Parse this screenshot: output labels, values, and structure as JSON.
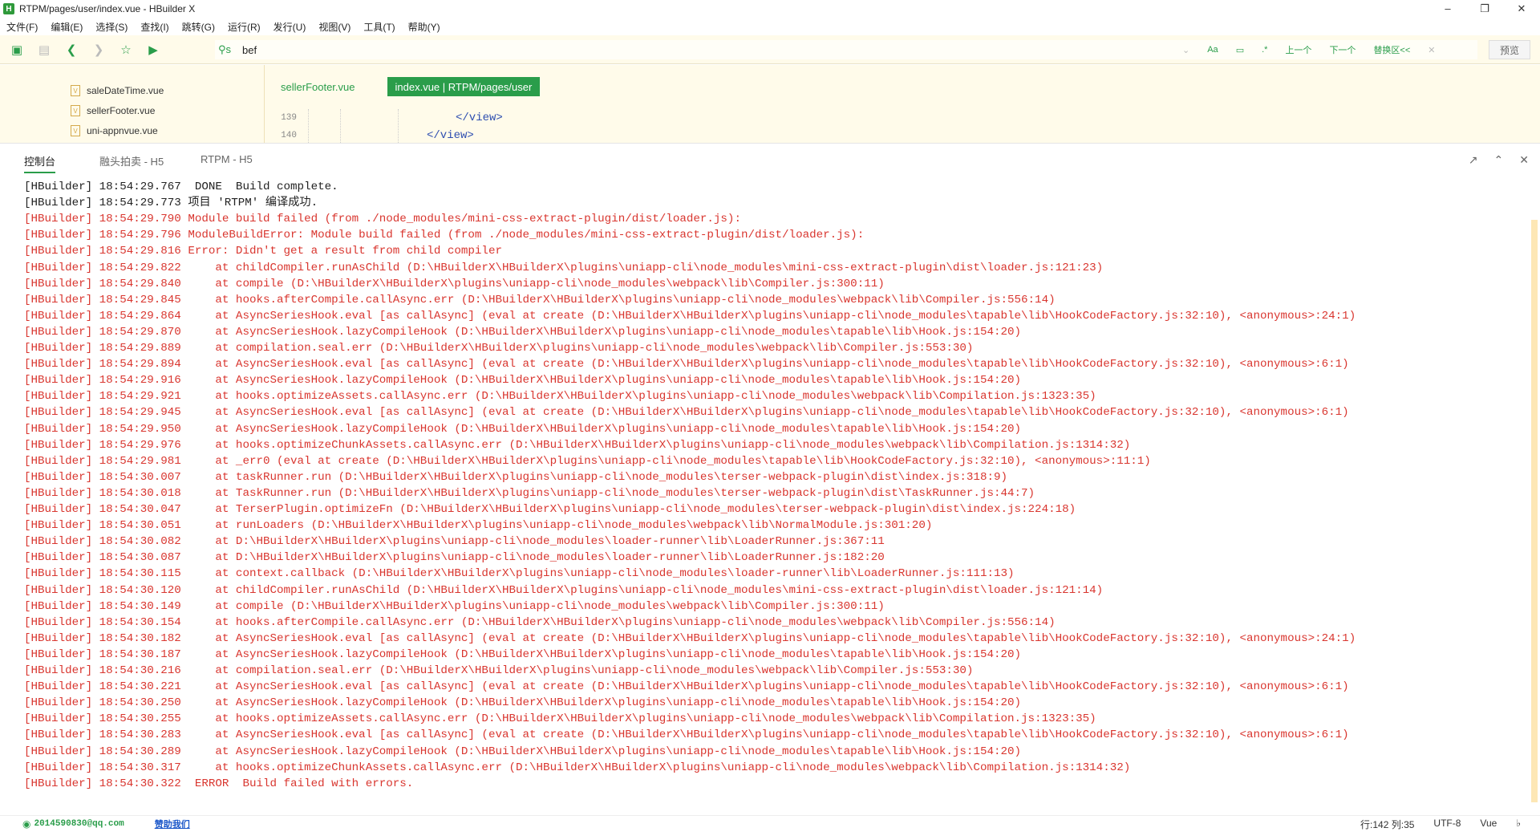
{
  "window": {
    "title": "RTPM/pages/user/index.vue - HBuilder X",
    "app_icon": "H"
  },
  "menu": [
    "文件(F)",
    "编辑(E)",
    "选择(S)",
    "查找(I)",
    "跳转(G)",
    "运行(R)",
    "发行(U)",
    "视图(V)",
    "工具(T)",
    "帮助(Y)"
  ],
  "search": {
    "value": "bef",
    "case": "Aa",
    "replace_all": "替换区<<",
    "prev": "上一个",
    "next": "下一个",
    "preview": "预览"
  },
  "tree": [
    "saleDateTime.vue",
    "sellerFooter.vue",
    "uni-appnvue.vue"
  ],
  "tabs": [
    "sellerFooter.vue",
    "index.vue | RTPM/pages/user"
  ],
  "gutter": [
    "139",
    "140"
  ],
  "code": [
    "</view>",
    "</view>"
  ],
  "console": {
    "tabs": [
      "控制台",
      "融头拍卖 - H5",
      "RTPM - H5"
    ],
    "lines": [
      {
        "t": "info",
        "text": "[HBuilder] 18:54:29.767  DONE  Build complete."
      },
      {
        "t": "info",
        "text": "[HBuilder] 18:54:29.773 项目 'RTPM' 编译成功."
      },
      {
        "t": "err",
        "text": "[HBuilder] 18:54:29.790 Module build failed (from ./node_modules/mini-css-extract-plugin/dist/loader.js):"
      },
      {
        "t": "err",
        "text": "[HBuilder] 18:54:29.796 ModuleBuildError: Module build failed (from ./node_modules/mini-css-extract-plugin/dist/loader.js):"
      },
      {
        "t": "err",
        "text": "[HBuilder] 18:54:29.816 Error: Didn't get a result from child compiler"
      },
      {
        "t": "err",
        "text": "[HBuilder] 18:54:29.822     at childCompiler.runAsChild (D:\\HBuilderX\\HBuilderX\\plugins\\uniapp-cli\\node_modules\\mini-css-extract-plugin\\dist\\loader.js:121:23)"
      },
      {
        "t": "err",
        "text": "[HBuilder] 18:54:29.840     at compile (D:\\HBuilderX\\HBuilderX\\plugins\\uniapp-cli\\node_modules\\webpack\\lib\\Compiler.js:300:11)"
      },
      {
        "t": "err",
        "text": "[HBuilder] 18:54:29.845     at hooks.afterCompile.callAsync.err (D:\\HBuilderX\\HBuilderX\\plugins\\uniapp-cli\\node_modules\\webpack\\lib\\Compiler.js:556:14)"
      },
      {
        "t": "err",
        "text": "[HBuilder] 18:54:29.864     at AsyncSeriesHook.eval [as callAsync] (eval at create (D:\\HBuilderX\\HBuilderX\\plugins\\uniapp-cli\\node_modules\\tapable\\lib\\HookCodeFactory.js:32:10), <anonymous>:24:1)"
      },
      {
        "t": "err",
        "text": "[HBuilder] 18:54:29.870     at AsyncSeriesHook.lazyCompileHook (D:\\HBuilderX\\HBuilderX\\plugins\\uniapp-cli\\node_modules\\tapable\\lib\\Hook.js:154:20)"
      },
      {
        "t": "err",
        "text": "[HBuilder] 18:54:29.889     at compilation.seal.err (D:\\HBuilderX\\HBuilderX\\plugins\\uniapp-cli\\node_modules\\webpack\\lib\\Compiler.js:553:30)"
      },
      {
        "t": "err",
        "text": "[HBuilder] 18:54:29.894     at AsyncSeriesHook.eval [as callAsync] (eval at create (D:\\HBuilderX\\HBuilderX\\plugins\\uniapp-cli\\node_modules\\tapable\\lib\\HookCodeFactory.js:32:10), <anonymous>:6:1)"
      },
      {
        "t": "err",
        "text": "[HBuilder] 18:54:29.916     at AsyncSeriesHook.lazyCompileHook (D:\\HBuilderX\\HBuilderX\\plugins\\uniapp-cli\\node_modules\\tapable\\lib\\Hook.js:154:20)"
      },
      {
        "t": "err",
        "text": "[HBuilder] 18:54:29.921     at hooks.optimizeAssets.callAsync.err (D:\\HBuilderX\\HBuilderX\\plugins\\uniapp-cli\\node_modules\\webpack\\lib\\Compilation.js:1323:35)"
      },
      {
        "t": "err",
        "text": "[HBuilder] 18:54:29.945     at AsyncSeriesHook.eval [as callAsync] (eval at create (D:\\HBuilderX\\HBuilderX\\plugins\\uniapp-cli\\node_modules\\tapable\\lib\\HookCodeFactory.js:32:10), <anonymous>:6:1)"
      },
      {
        "t": "err",
        "text": "[HBuilder] 18:54:29.950     at AsyncSeriesHook.lazyCompileHook (D:\\HBuilderX\\HBuilderX\\plugins\\uniapp-cli\\node_modules\\tapable\\lib\\Hook.js:154:20)"
      },
      {
        "t": "err",
        "text": "[HBuilder] 18:54:29.976     at hooks.optimizeChunkAssets.callAsync.err (D:\\HBuilderX\\HBuilderX\\plugins\\uniapp-cli\\node_modules\\webpack\\lib\\Compilation.js:1314:32)"
      },
      {
        "t": "err",
        "text": "[HBuilder] 18:54:29.981     at _err0 (eval at create (D:\\HBuilderX\\HBuilderX\\plugins\\uniapp-cli\\node_modules\\tapable\\lib\\HookCodeFactory.js:32:10), <anonymous>:11:1)"
      },
      {
        "t": "err",
        "text": "[HBuilder] 18:54:30.007     at taskRunner.run (D:\\HBuilderX\\HBuilderX\\plugins\\uniapp-cli\\node_modules\\terser-webpack-plugin\\dist\\index.js:318:9)"
      },
      {
        "t": "err",
        "text": "[HBuilder] 18:54:30.018     at TaskRunner.run (D:\\HBuilderX\\HBuilderX\\plugins\\uniapp-cli\\node_modules\\terser-webpack-plugin\\dist\\TaskRunner.js:44:7)"
      },
      {
        "t": "err",
        "text": "[HBuilder] 18:54:30.047     at TerserPlugin.optimizeFn (D:\\HBuilderX\\HBuilderX\\plugins\\uniapp-cli\\node_modules\\terser-webpack-plugin\\dist\\index.js:224:18)"
      },
      {
        "t": "err",
        "text": "[HBuilder] 18:54:30.051     at runLoaders (D:\\HBuilderX\\HBuilderX\\plugins\\uniapp-cli\\node_modules\\webpack\\lib\\NormalModule.js:301:20)"
      },
      {
        "t": "err",
        "text": "[HBuilder] 18:54:30.082     at D:\\HBuilderX\\HBuilderX\\plugins\\uniapp-cli\\node_modules\\loader-runner\\lib\\LoaderRunner.js:367:11"
      },
      {
        "t": "err",
        "text": "[HBuilder] 18:54:30.087     at D:\\HBuilderX\\HBuilderX\\plugins\\uniapp-cli\\node_modules\\loader-runner\\lib\\LoaderRunner.js:182:20"
      },
      {
        "t": "err",
        "text": "[HBuilder] 18:54:30.115     at context.callback (D:\\HBuilderX\\HBuilderX\\plugins\\uniapp-cli\\node_modules\\loader-runner\\lib\\LoaderRunner.js:111:13)"
      },
      {
        "t": "err",
        "text": "[HBuilder] 18:54:30.120     at childCompiler.runAsChild (D:\\HBuilderX\\HBuilderX\\plugins\\uniapp-cli\\node_modules\\mini-css-extract-plugin\\dist\\loader.js:121:14)"
      },
      {
        "t": "err",
        "text": "[HBuilder] 18:54:30.149     at compile (D:\\HBuilderX\\HBuilderX\\plugins\\uniapp-cli\\node_modules\\webpack\\lib\\Compiler.js:300:11)"
      },
      {
        "t": "err",
        "text": "[HBuilder] 18:54:30.154     at hooks.afterCompile.callAsync.err (D:\\HBuilderX\\HBuilderX\\plugins\\uniapp-cli\\node_modules\\webpack\\lib\\Compiler.js:556:14)"
      },
      {
        "t": "err",
        "text": "[HBuilder] 18:54:30.182     at AsyncSeriesHook.eval [as callAsync] (eval at create (D:\\HBuilderX\\HBuilderX\\plugins\\uniapp-cli\\node_modules\\tapable\\lib\\HookCodeFactory.js:32:10), <anonymous>:24:1)"
      },
      {
        "t": "err",
        "text": "[HBuilder] 18:54:30.187     at AsyncSeriesHook.lazyCompileHook (D:\\HBuilderX\\HBuilderX\\plugins\\uniapp-cli\\node_modules\\tapable\\lib\\Hook.js:154:20)"
      },
      {
        "t": "err",
        "text": "[HBuilder] 18:54:30.216     at compilation.seal.err (D:\\HBuilderX\\HBuilderX\\plugins\\uniapp-cli\\node_modules\\webpack\\lib\\Compiler.js:553:30)"
      },
      {
        "t": "err",
        "text": "[HBuilder] 18:54:30.221     at AsyncSeriesHook.eval [as callAsync] (eval at create (D:\\HBuilderX\\HBuilderX\\plugins\\uniapp-cli\\node_modules\\tapable\\lib\\HookCodeFactory.js:32:10), <anonymous>:6:1)"
      },
      {
        "t": "err",
        "text": "[HBuilder] 18:54:30.250     at AsyncSeriesHook.lazyCompileHook (D:\\HBuilderX\\HBuilderX\\plugins\\uniapp-cli\\node_modules\\tapable\\lib\\Hook.js:154:20)"
      },
      {
        "t": "err",
        "text": "[HBuilder] 18:54:30.255     at hooks.optimizeAssets.callAsync.err (D:\\HBuilderX\\HBuilderX\\plugins\\uniapp-cli\\node_modules\\webpack\\lib\\Compilation.js:1323:35)"
      },
      {
        "t": "err",
        "text": "[HBuilder] 18:54:30.283     at AsyncSeriesHook.eval [as callAsync] (eval at create (D:\\HBuilderX\\HBuilderX\\plugins\\uniapp-cli\\node_modules\\tapable\\lib\\HookCodeFactory.js:32:10), <anonymous>:6:1)"
      },
      {
        "t": "err",
        "text": "[HBuilder] 18:54:30.289     at AsyncSeriesHook.lazyCompileHook (D:\\HBuilderX\\HBuilderX\\plugins\\uniapp-cli\\node_modules\\tapable\\lib\\Hook.js:154:20)"
      },
      {
        "t": "err",
        "text": "[HBuilder] 18:54:30.317     at hooks.optimizeChunkAssets.callAsync.err (D:\\HBuilderX\\HBuilderX\\plugins\\uniapp-cli\\node_modules\\webpack\\lib\\Compilation.js:1314:32)"
      },
      {
        "t": "err",
        "text": "[HBuilder] 18:54:30.322  ERROR  Build failed with errors."
      }
    ]
  },
  "status": {
    "user": "2014590830@qq.com",
    "help": "赞助我们",
    "pos": "行:142  列:35",
    "encoding": "UTF-8",
    "lang": "Vue"
  }
}
